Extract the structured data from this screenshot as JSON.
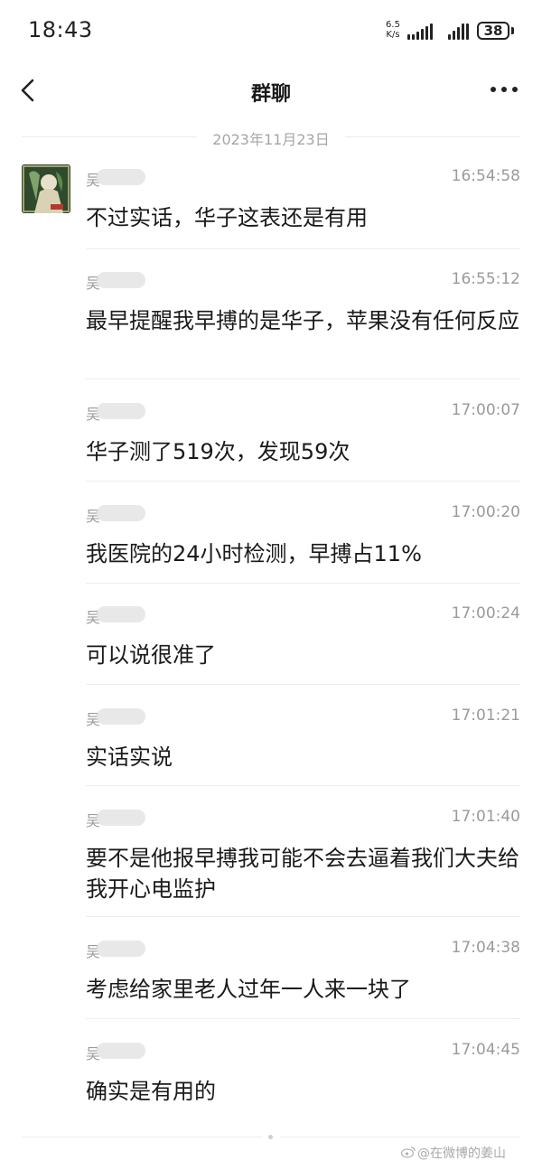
{
  "status_bar": {
    "time": "18:43",
    "net_speed_value": "6.5",
    "net_speed_unit": "K/s",
    "battery": "38"
  },
  "header": {
    "title": "群聊"
  },
  "date_separator": "2023年11月23日",
  "messages": [
    {
      "sender": "吴",
      "time": "16:54:58",
      "text": "不过实话，华子这表还是有用"
    },
    {
      "sender": "吴",
      "time": "16:55:12",
      "text": "最早提醒我早搏的是华子，苹果没有任何反应"
    },
    {
      "sender": "吴",
      "time": "17:00:07",
      "text": "华子测了519次，发现59次"
    },
    {
      "sender": "吴",
      "time": "17:00:20",
      "text": "我医院的24小时检测，早搏占11%"
    },
    {
      "sender": "吴",
      "time": "17:00:24",
      "text": "可以说很准了"
    },
    {
      "sender": "吴",
      "time": "17:01:21",
      "text": "实话实说"
    },
    {
      "sender": "吴",
      "time": "17:01:40",
      "text": "要不是他报早搏我可能不会去逼着我们大夫给我开心电监护"
    },
    {
      "sender": "吴",
      "time": "17:04:38",
      "text": "考虑给家里老人过年一人来一块了"
    },
    {
      "sender": "吴",
      "time": "17:04:45",
      "text": "确实是有用的"
    }
  ],
  "watermark": "@在微博的姜山",
  "icons": [
    "back-icon",
    "more-icon",
    "signal-icon",
    "battery-icon",
    "weibo-icon"
  ],
  "colors": {
    "timestamp": "#9a9a9a",
    "divider": "#eeeeee",
    "text": "#1a1a1a"
  }
}
